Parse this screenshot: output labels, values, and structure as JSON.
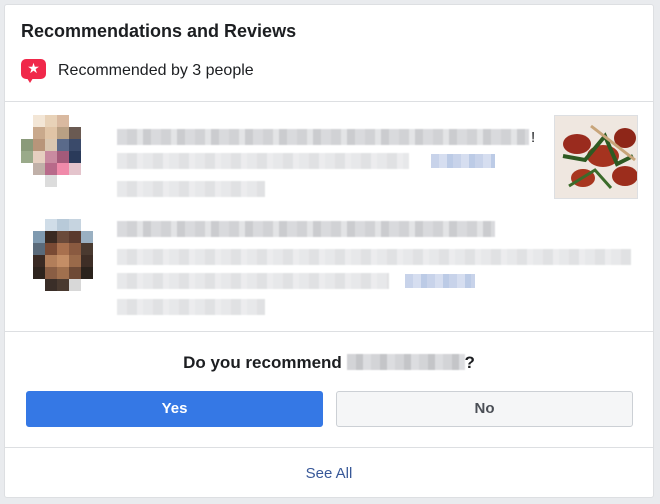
{
  "card": {
    "title": "Recommendations and Reviews",
    "recommended_text": "Recommended by 3 people",
    "recommend_icon": "recommendation-star-bubble-icon"
  },
  "reviews": [
    {
      "trailing_text": "!"
    },
    {
      "trailing_text": ""
    }
  ],
  "prompt": {
    "question_prefix": "Do you recommend ",
    "question_suffix": "?",
    "yes_label": "Yes",
    "no_label": "No"
  },
  "footer": {
    "see_all_label": "See All"
  },
  "colors": {
    "primary_blue": "#3578e5",
    "link_blue": "#385898",
    "recommend_red": "#f0284a"
  }
}
